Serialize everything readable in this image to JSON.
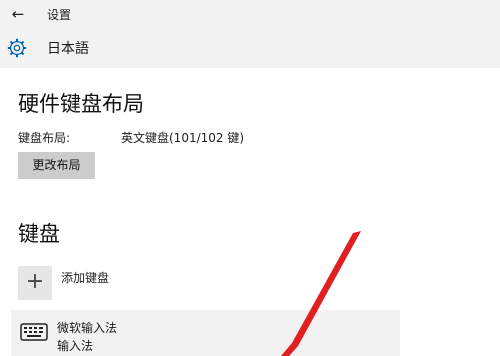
{
  "window": {
    "title": "设置",
    "back_icon": "arrow-left-icon"
  },
  "header": {
    "title": "日本語",
    "icon": "gear-icon"
  },
  "hardware_layout": {
    "title": "硬件键盘布局",
    "label": "键盘布局:",
    "value": "英文键盘(101/102 键)",
    "button_label": "更改布局"
  },
  "keyboards": {
    "title": "键盘",
    "add_label": "添加键盘",
    "add_icon": "plus-icon",
    "items": [
      {
        "name": "微软输入法",
        "subtitle": "输入法",
        "icon": "keyboard-icon"
      }
    ]
  },
  "colors": {
    "accent": "#0063b1",
    "annotation_arrow": "#e02020"
  }
}
